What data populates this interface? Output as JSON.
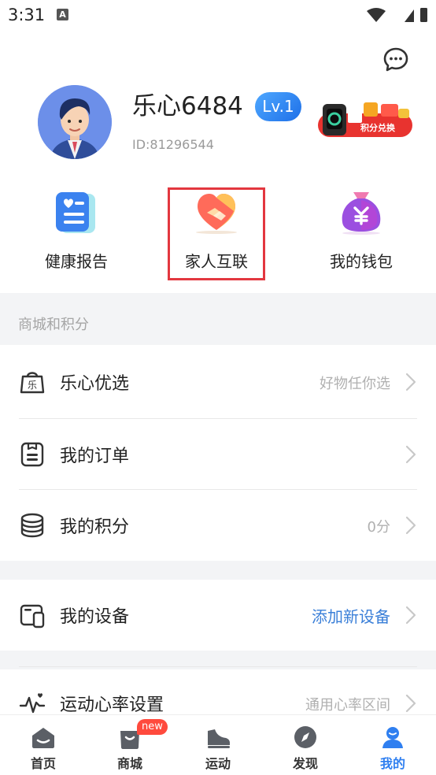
{
  "status_bar": {
    "time": "3:31",
    "notification_letter": "A"
  },
  "profile": {
    "nickname": "乐心6484",
    "level": "Lv.1",
    "user_id": "ID:81296544",
    "banner_label": "积分兑换"
  },
  "quick_actions": [
    {
      "label": "健康报告",
      "icon": "health-report-icon"
    },
    {
      "label": "家人互联",
      "icon": "family-handshake-icon",
      "highlighted": true
    },
    {
      "label": "我的钱包",
      "icon": "wallet-bag-icon"
    }
  ],
  "mall_section": {
    "title": "商城和积分",
    "rows": [
      {
        "label": "乐心优选",
        "value": "好物任你选",
        "icon": "shopping-bag-icon"
      },
      {
        "label": "我的订单",
        "value": "",
        "icon": "order-icon"
      },
      {
        "label": "我的积分",
        "value": "0分",
        "icon": "coins-icon"
      }
    ]
  },
  "device_row": {
    "label": "我的设备",
    "value": "添加新设备",
    "icon": "watch-device-icon"
  },
  "heart_rate_row": {
    "label": "运动心率设置",
    "value": "通用心率区间",
    "icon": "heart-rate-icon"
  },
  "bottom_nav": {
    "items": [
      {
        "label": "首页",
        "icon": "home-icon"
      },
      {
        "label": "商城",
        "icon": "mall-icon",
        "badge": "new"
      },
      {
        "label": "运动",
        "icon": "sport-shoe-icon"
      },
      {
        "label": "发现",
        "icon": "compass-icon"
      },
      {
        "label": "我的",
        "icon": "profile-icon",
        "active": true
      }
    ]
  },
  "colors": {
    "accent": "#2f7ff0",
    "highlight_border": "#e3373f",
    "section_bg": "#f3f4f6",
    "badge": "#ff4a3d"
  }
}
